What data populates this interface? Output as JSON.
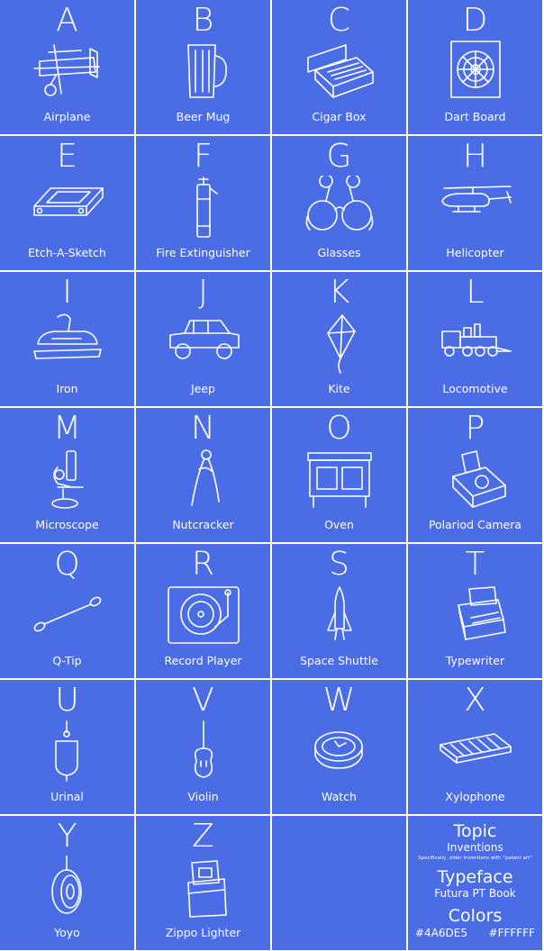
{
  "colors": {
    "background": "#4A6DE5",
    "foreground": "#FFFFFF"
  },
  "tiles": [
    {
      "letter": "A",
      "name": "Airplane",
      "icon": "airplane-icon"
    },
    {
      "letter": "B",
      "name": "Beer Mug",
      "icon": "beer-mug-icon"
    },
    {
      "letter": "C",
      "name": "Cigar Box",
      "icon": "cigar-box-icon"
    },
    {
      "letter": "D",
      "name": "Dart Board",
      "icon": "dart-board-icon"
    },
    {
      "letter": "E",
      "name": "Etch-A-Sketch",
      "icon": "etch-a-sketch-icon"
    },
    {
      "letter": "F",
      "name": "Fire Extinguisher",
      "icon": "fire-extinguisher-icon"
    },
    {
      "letter": "G",
      "name": "Glasses",
      "icon": "glasses-icon"
    },
    {
      "letter": "H",
      "name": "Helicopter",
      "icon": "helicopter-icon"
    },
    {
      "letter": "I",
      "name": "Iron",
      "icon": "iron-icon"
    },
    {
      "letter": "J",
      "name": "Jeep",
      "icon": "jeep-icon"
    },
    {
      "letter": "K",
      "name": "Kite",
      "icon": "kite-icon"
    },
    {
      "letter": "L",
      "name": "Locomotive",
      "icon": "locomotive-icon"
    },
    {
      "letter": "M",
      "name": "Microscope",
      "icon": "microscope-icon"
    },
    {
      "letter": "N",
      "name": "Nutcracker",
      "icon": "nutcracker-icon"
    },
    {
      "letter": "O",
      "name": "Oven",
      "icon": "oven-icon"
    },
    {
      "letter": "P",
      "name": "Polariod Camera",
      "icon": "polaroid-camera-icon"
    },
    {
      "letter": "Q",
      "name": "Q-Tip",
      "icon": "q-tip-icon"
    },
    {
      "letter": "R",
      "name": "Record Player",
      "icon": "record-player-icon"
    },
    {
      "letter": "S",
      "name": "Space Shuttle",
      "icon": "space-shuttle-icon"
    },
    {
      "letter": "T",
      "name": "Typewriter",
      "icon": "typewriter-icon"
    },
    {
      "letter": "U",
      "name": "Urinal",
      "icon": "urinal-icon"
    },
    {
      "letter": "V",
      "name": "Violin",
      "icon": "violin-icon"
    },
    {
      "letter": "W",
      "name": "Watch",
      "icon": "watch-icon"
    },
    {
      "letter": "X",
      "name": "Xylophone",
      "icon": "xylophone-icon"
    },
    {
      "letter": "Y",
      "name": "Yoyo",
      "icon": "yoyo-icon"
    },
    {
      "letter": "Z",
      "name": "Zippo Lighter",
      "icon": "zippo-lighter-icon"
    }
  ],
  "legend": {
    "topic_heading": "Topic",
    "topic_value": "Inventions",
    "topic_note": "Specifically, older inventions with \"patent art\"",
    "typeface_heading": "Typeface",
    "typeface_value": "Futura PT Book",
    "colors_heading": "Colors",
    "color_1": "#4A6DE5",
    "color_2": "#FFFFFF"
  }
}
